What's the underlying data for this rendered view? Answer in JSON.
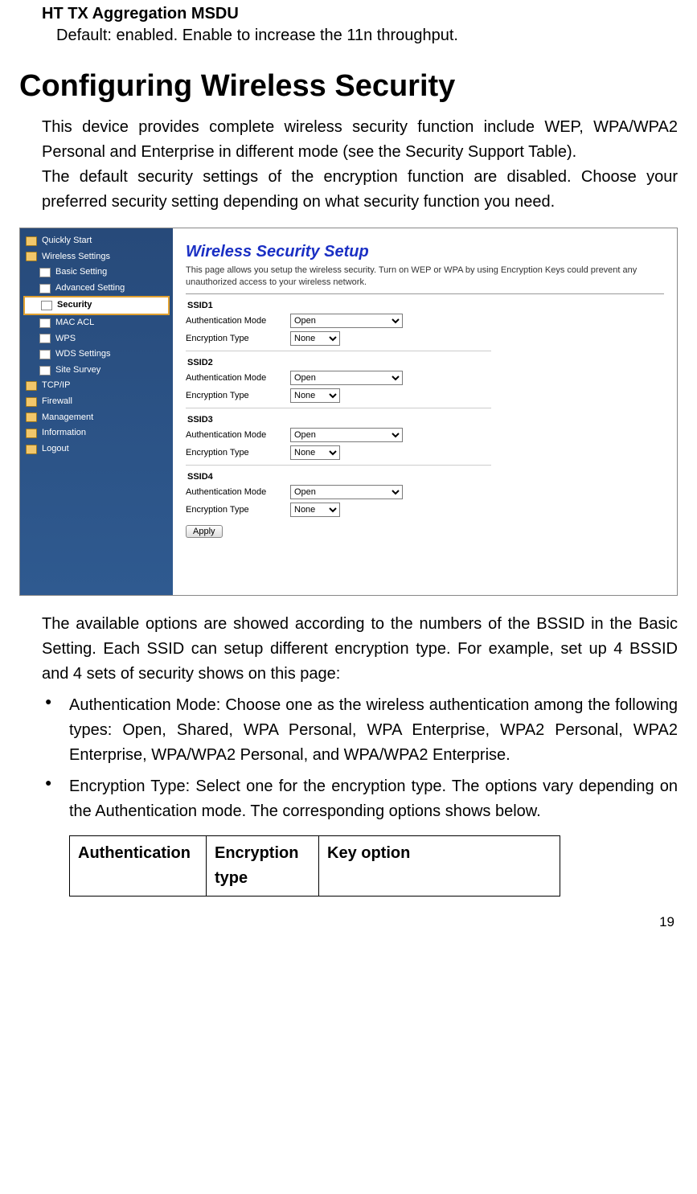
{
  "section": {
    "sub_heading": "HT TX Aggregation MSDU",
    "sub_desc": "Default: enabled. Enable to increase the 11n throughput."
  },
  "heading": "Configuring Wireless Security",
  "para1": "This device provides complete wireless security function include WEP, WPA/WPA2 Personal and Enterprise in different mode (see the Security Support Table).",
  "para2": "The default security settings of the encryption function are disabled. Choose your preferred security setting depending on what security function you need.",
  "nav": {
    "items": [
      {
        "label": "Quickly Start",
        "type": "folder",
        "child": false,
        "selected": false
      },
      {
        "label": "Wireless Settings",
        "type": "folder",
        "child": false,
        "selected": false
      },
      {
        "label": "Basic Setting",
        "type": "page",
        "child": true,
        "selected": false
      },
      {
        "label": "Advanced Setting",
        "type": "page",
        "child": true,
        "selected": false
      },
      {
        "label": "Security",
        "type": "page",
        "child": true,
        "selected": true
      },
      {
        "label": "MAC ACL",
        "type": "page",
        "child": true,
        "selected": false
      },
      {
        "label": "WPS",
        "type": "page",
        "child": true,
        "selected": false
      },
      {
        "label": "WDS Settings",
        "type": "page",
        "child": true,
        "selected": false
      },
      {
        "label": "Site Survey",
        "type": "page",
        "child": true,
        "selected": false
      },
      {
        "label": "TCP/IP",
        "type": "folder",
        "child": false,
        "selected": false
      },
      {
        "label": "Firewall",
        "type": "folder",
        "child": false,
        "selected": false
      },
      {
        "label": "Management",
        "type": "folder",
        "child": false,
        "selected": false
      },
      {
        "label": "Information",
        "type": "folder",
        "child": false,
        "selected": false
      },
      {
        "label": "Logout",
        "type": "folder",
        "child": false,
        "selected": false
      }
    ]
  },
  "panel": {
    "title": "Wireless Security Setup",
    "desc": "This page allows you setup the wireless security. Turn on WEP or WPA by using Encryption Keys could prevent any unauthorized access to your wireless network.",
    "auth_label": "Authentication Mode",
    "enc_label": "Encryption Type",
    "ssids": [
      {
        "name": "SSID1",
        "auth": "Open",
        "enc": "None"
      },
      {
        "name": "SSID2",
        "auth": "Open",
        "enc": "None"
      },
      {
        "name": "SSID3",
        "auth": "Open",
        "enc": "None"
      },
      {
        "name": "SSID4",
        "auth": "Open",
        "enc": "None"
      }
    ],
    "apply": "Apply"
  },
  "para3": "The available options are showed according to the numbers of the BSSID in the Basic Setting. Each SSID can setup different encryption type. For example, set up 4 BSSID and 4 sets of security shows on this page:",
  "bullets": [
    "Authentication Mode: Choose one as the wireless authentication among the following types: Open, Shared, WPA Personal, WPA Enterprise, WPA2 Personal, WPA2 Enterprise, WPA/WPA2 Personal, and WPA/WPA2 Enterprise.",
    "Encryption Type: Select one for the encryption type. The options vary depending on the Authentication mode. The corresponding options shows below."
  ],
  "table": {
    "headers": [
      "Authentication",
      "Encryption type",
      "Key option"
    ]
  },
  "page_number": "19"
}
